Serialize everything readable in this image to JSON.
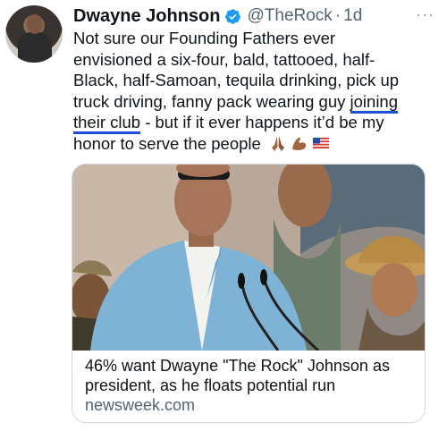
{
  "tweet": {
    "author_name": "Dwayne Johnson",
    "handle": "@TheRock",
    "separator": "·",
    "timestamp": "1d",
    "more": "···",
    "text_lines": [
      "Not sure our Founding Fathers ever",
      "envisioned a six-four, bald, tattooed, half-",
      "Black, half-Samoan, tequila drinking, pick up",
      "truck driving, fanny pack wearing guy ",
      "joining",
      "their club",
      " - but if it ever happens it’d be my",
      "honor to serve the people"
    ],
    "emojis": [
      "folded-hands-emoji",
      "flexed-biceps-emoji",
      "us-flag-emoji"
    ]
  },
  "card": {
    "title_lines": [
      "46% want Dwayne \"The Rock\" Johnson as",
      "president, as he floats potential run"
    ],
    "domain": "newsweek.com"
  },
  "colors": {
    "text": "#0f1419",
    "muted": "#536471",
    "verified": "#1d9bf0",
    "underline": "#1d4ed8",
    "card_border": "#cfd9de",
    "jacket": "#7fb3d6"
  }
}
